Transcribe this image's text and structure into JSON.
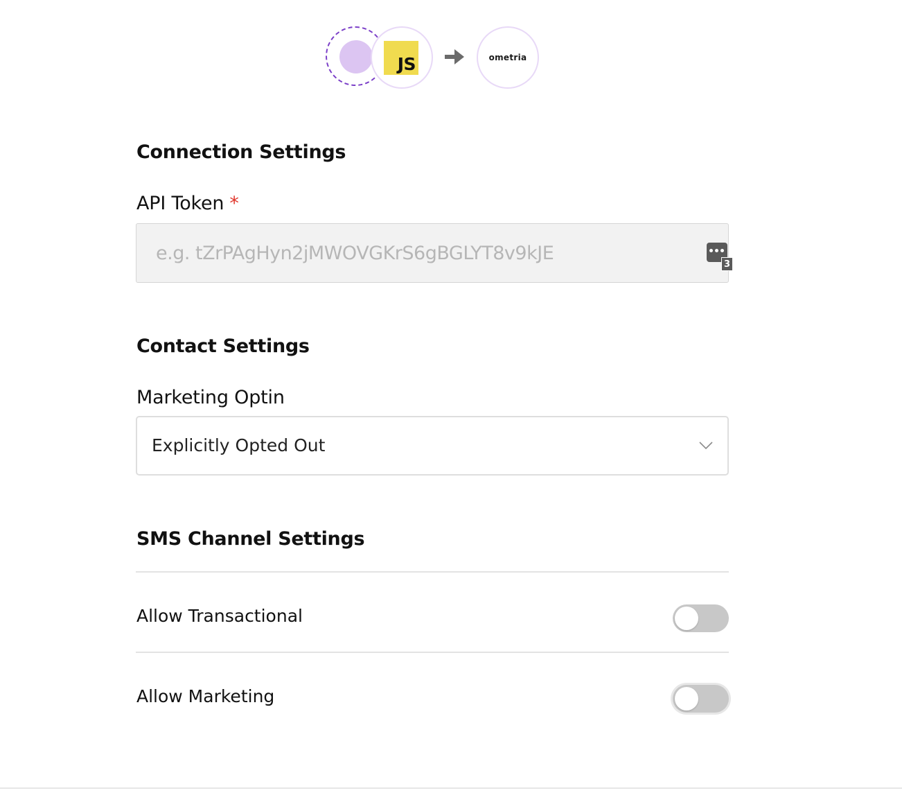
{
  "integration_header": {
    "source_icon": "circle-placeholder-icon",
    "tool_icon": "javascript-icon",
    "tool_label": "JS",
    "arrow_icon": "arrow-right-icon",
    "destination_logo": "ometria"
  },
  "connection_settings": {
    "title": "Connection Settings",
    "api_token": {
      "label": "API Token",
      "required_mark": "*",
      "value": "",
      "placeholder": "e.g. tZrPAgHyn2jMWOVGKrS6gBGLYT8v9kJE",
      "password_manager_icon": "password-manager-icon",
      "password_manager_count": "3"
    }
  },
  "contact_settings": {
    "title": "Contact Settings",
    "marketing_optin": {
      "label": "Marketing Optin",
      "selected": "Explicitly Opted Out",
      "chevron_icon": "chevron-down-icon"
    }
  },
  "sms_channel_settings": {
    "title": "SMS Channel Settings",
    "toggles": [
      {
        "label": "Allow Transactional",
        "on": false
      },
      {
        "label": "Allow Marketing",
        "on": false
      }
    ]
  },
  "colors": {
    "accent_purple": "#7b3fc8",
    "soft_purple": "#dcc5f2",
    "js_yellow": "#f0db4f",
    "required_red": "#e0352b",
    "toggle_off": "#c8c8c8"
  }
}
